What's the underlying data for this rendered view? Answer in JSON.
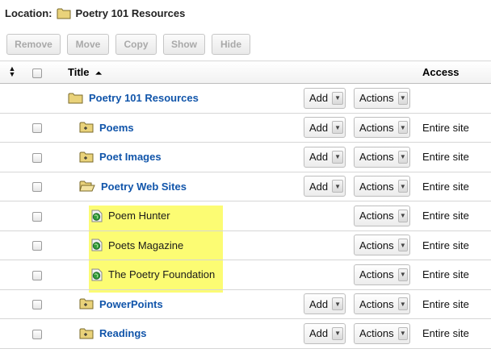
{
  "location": {
    "label": "Location:",
    "path": "Poetry 101 Resources"
  },
  "toolbar": {
    "remove": "Remove",
    "move": "Move",
    "copy": "Copy",
    "show": "Show",
    "hide": "Hide"
  },
  "table": {
    "headers": {
      "title": "Title",
      "access": "Access"
    },
    "rows": [
      {
        "title": "Poetry 101 Resources",
        "icon": "folder-open-icon",
        "add": "Add",
        "actions": "Actions",
        "access": ""
      },
      {
        "title": "Poems",
        "icon": "folder-plus-icon",
        "add": "Add",
        "actions": "Actions",
        "access": "Entire site"
      },
      {
        "title": "Poet Images",
        "icon": "folder-plus-icon",
        "add": "Add",
        "actions": "Actions",
        "access": "Entire site"
      },
      {
        "title": "Poetry Web Sites",
        "icon": "folder-open-icon",
        "add": "Add",
        "actions": "Actions",
        "access": "Entire site"
      },
      {
        "title": "Poem Hunter",
        "icon": "weblink-icon",
        "add": "",
        "actions": "Actions",
        "access": "Entire site"
      },
      {
        "title": "Poets Magazine",
        "icon": "weblink-icon",
        "add": "",
        "actions": "Actions",
        "access": "Entire site"
      },
      {
        "title": "The Poetry Foundation",
        "icon": "weblink-icon",
        "add": "",
        "actions": "Actions",
        "access": "Entire site"
      },
      {
        "title": "PowerPoints",
        "icon": "folder-plus-icon",
        "add": "Add",
        "actions": "Actions",
        "access": "Entire site"
      },
      {
        "title": "Readings",
        "icon": "folder-plus-icon",
        "add": "Add",
        "actions": "Actions",
        "access": "Entire site"
      }
    ]
  },
  "colors": {
    "link": "#1155aa",
    "highlight": "#fbfb5a",
    "folder": "#e8d070"
  }
}
